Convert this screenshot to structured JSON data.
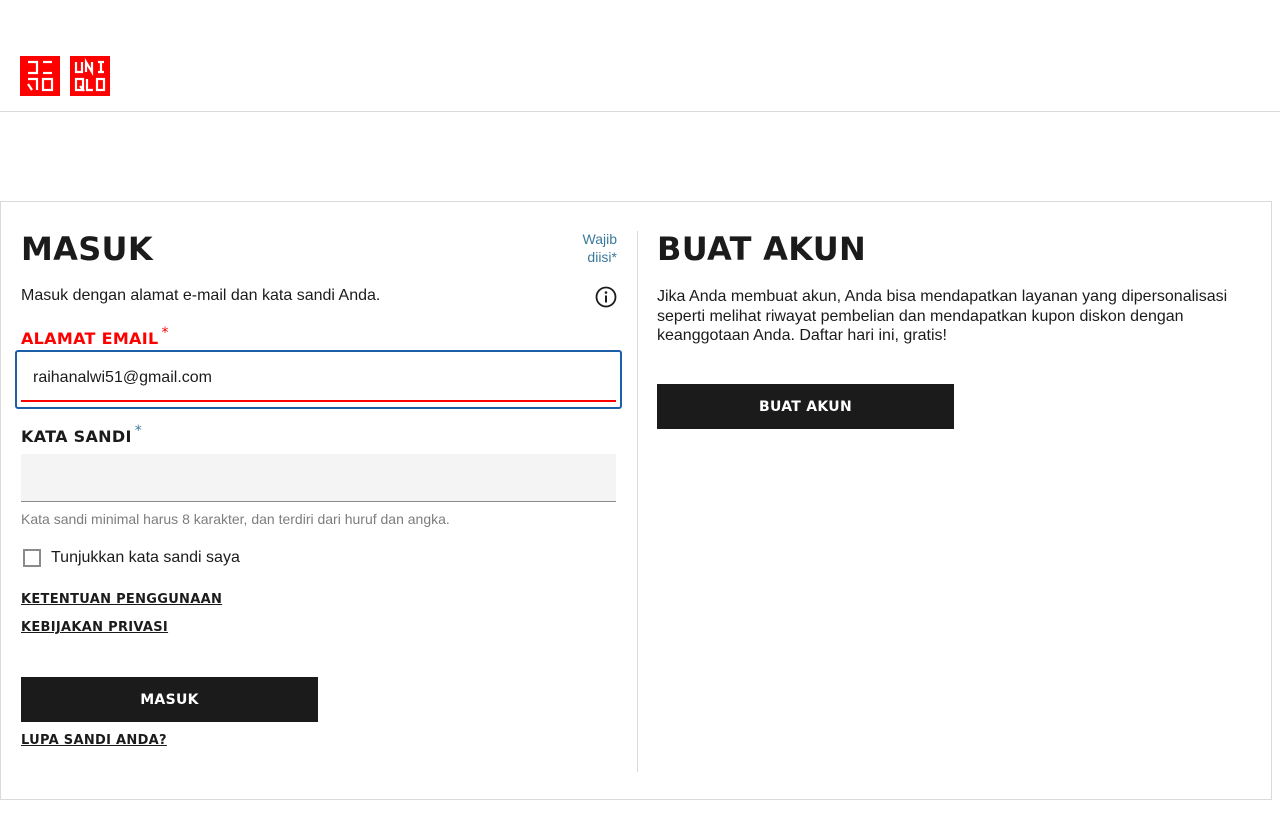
{
  "logo": {
    "brand": "UNIQLO",
    "line1": "UNI",
    "line2": "QLO",
    "color": "#ff0000"
  },
  "login": {
    "title": "MASUK",
    "required_line1": "Wajib",
    "required_line2": "diisi",
    "required_star": "*",
    "intro": "Masuk dengan alamat e-mail dan kata sandi Anda.",
    "info_icon": "info-icon",
    "email_label": "ALAMAT EMAIL",
    "email_required": "*",
    "email_value": "raihanalwi51@gmail.com",
    "password_label": "KATA SANDI",
    "password_required": "*",
    "password_value": "",
    "password_hint": "Kata sandi minimal harus 8 karakter, dan terdiri dari huruf dan angka.",
    "show_password_label": "Tunjukkan kata sandi saya",
    "show_password_checked": false,
    "terms_link": "KETENTUAN PENGGUNAAN",
    "privacy_link": "KEBIJAKAN PRIVASI",
    "login_button": "MASUK",
    "forgot_link": "LUPA SANDI ANDA?"
  },
  "register": {
    "title": "BUAT AKUN",
    "intro": "Jika Anda membuat akun, Anda bisa mendapatkan layanan yang dipersonalisasi seperti melihat riwayat pembelian dan mendapatkan kupon diskon dengan keanggotaan Anda. Daftar hari ini, gratis!",
    "create_button": "BUAT AKUN"
  },
  "colors": {
    "accent_red": "#ff0000",
    "focus_blue": "#1c5ea8",
    "button_dark": "#1b1b1b",
    "required_teal": "#3b7a9c"
  }
}
